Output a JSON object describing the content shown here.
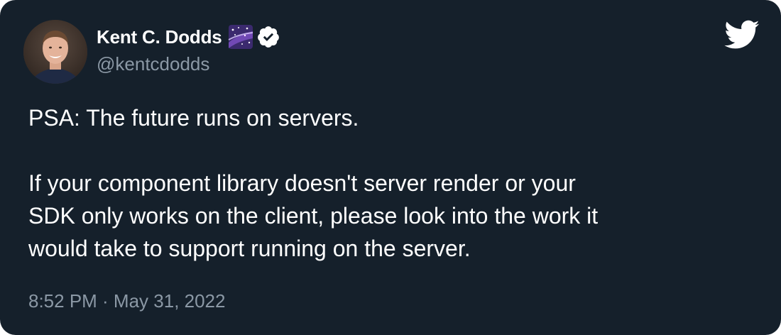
{
  "author": {
    "display_name": "Kent C. Dodds",
    "handle": "@kentcdodds",
    "avatar_icon": "profile-photo",
    "badge_icon": "milky-way-emoji",
    "verified_icon": "verified-badge-icon"
  },
  "brand": {
    "logo_icon": "twitter-bird-icon",
    "background": "#15202b",
    "text_color": "#ffffff",
    "muted_color": "#8b98a5"
  },
  "tweet": {
    "paragraph1": "PSA: The future runs on servers.",
    "paragraph2_lines": [
      "If your component library doesn't server render or your",
      "SDK only works on the client, please look into the work it",
      "would take to support running on the server."
    ],
    "timestamp": "8:52 PM · May 31, 2022"
  }
}
